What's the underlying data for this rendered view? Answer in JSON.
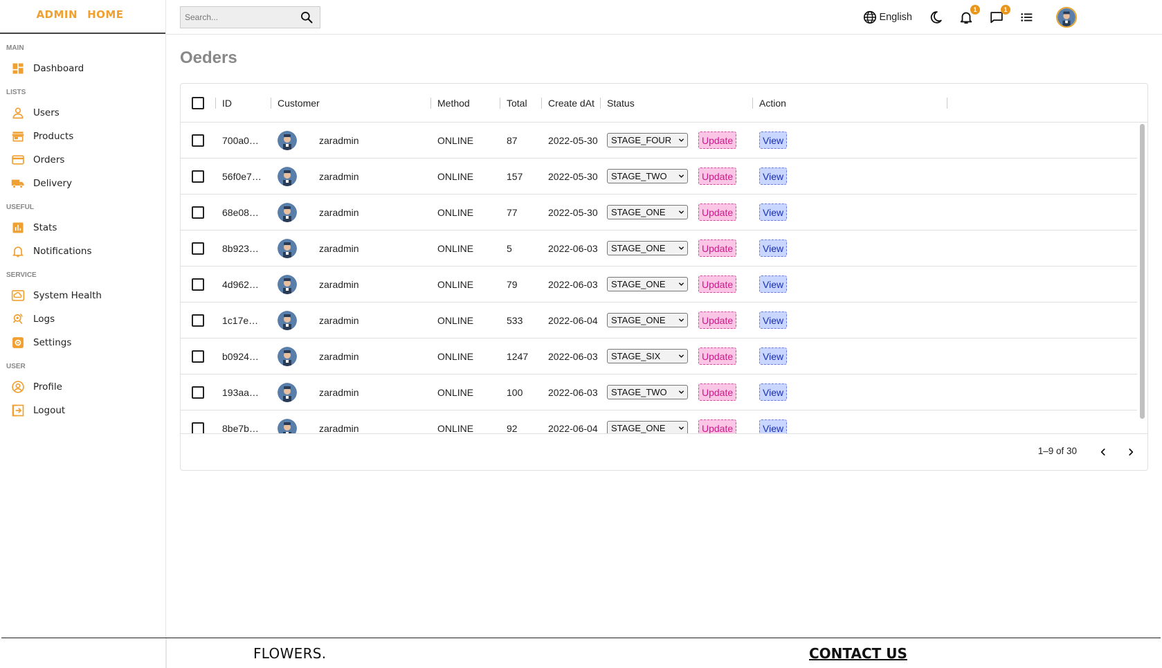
{
  "brand": {
    "part1": "ADMIN",
    "part2": "HOME"
  },
  "sidebar": {
    "sections": [
      {
        "title": "MAIN",
        "items": [
          {
            "label": "Dashboard",
            "icon": "dashboard-icon"
          }
        ]
      },
      {
        "title": "LISTS",
        "items": [
          {
            "label": "Users",
            "icon": "user-icon"
          },
          {
            "label": "Products",
            "icon": "store-icon"
          },
          {
            "label": "Orders",
            "icon": "credit-card-icon"
          },
          {
            "label": "Delivery",
            "icon": "truck-icon"
          }
        ]
      },
      {
        "title": "USEFUL",
        "items": [
          {
            "label": "Stats",
            "icon": "stats-icon"
          },
          {
            "label": "Notifications",
            "icon": "bell-icon"
          }
        ]
      },
      {
        "title": "SERVICE",
        "items": [
          {
            "label": "System Health",
            "icon": "system-health-icon"
          },
          {
            "label": "Logs",
            "icon": "logs-icon"
          },
          {
            "label": "Settings",
            "icon": "settings-icon"
          }
        ]
      },
      {
        "title": "USER",
        "items": [
          {
            "label": "Profile",
            "icon": "profile-icon"
          },
          {
            "label": "Logout",
            "icon": "logout-icon"
          }
        ]
      }
    ]
  },
  "topbar": {
    "search_placeholder": "Search...",
    "language": "English",
    "notifications_count": "1",
    "messages_count": "1"
  },
  "page": {
    "title": "Oeders"
  },
  "table": {
    "columns": [
      "ID",
      "Customer",
      "Method",
      "Total",
      "Create dAt",
      "Status",
      "Action"
    ],
    "rows": [
      {
        "id": "700a0…",
        "customer": "zaradmin",
        "method": "ONLINE",
        "total": "87",
        "created": "2022-05-30",
        "status": "STAGE_FOUR"
      },
      {
        "id": "56f0e7…",
        "customer": "zaradmin",
        "method": "ONLINE",
        "total": "157",
        "created": "2022-05-30",
        "status": "STAGE_TWO"
      },
      {
        "id": "68e08…",
        "customer": "zaradmin",
        "method": "ONLINE",
        "total": "77",
        "created": "2022-05-30",
        "status": "STAGE_ONE"
      },
      {
        "id": "8b923…",
        "customer": "zaradmin",
        "method": "ONLINE",
        "total": "5",
        "created": "2022-06-03",
        "status": "STAGE_ONE"
      },
      {
        "id": "4d962…",
        "customer": "zaradmin",
        "method": "ONLINE",
        "total": "79",
        "created": "2022-06-03",
        "status": "STAGE_ONE"
      },
      {
        "id": "1c17e…",
        "customer": "zaradmin",
        "method": "ONLINE",
        "total": "533",
        "created": "2022-06-04",
        "status": "STAGE_ONE"
      },
      {
        "id": "b0924…",
        "customer": "zaradmin",
        "method": "ONLINE",
        "total": "1247",
        "created": "2022-06-03",
        "status": "STAGE_SIX"
      },
      {
        "id": "193aa…",
        "customer": "zaradmin",
        "method": "ONLINE",
        "total": "100",
        "created": "2022-06-03",
        "status": "STAGE_TWO"
      },
      {
        "id": "8be7b…",
        "customer": "zaradmin",
        "method": "ONLINE",
        "total": "92",
        "created": "2022-06-04",
        "status": "STAGE_ONE"
      }
    ],
    "update_label": "Update",
    "view_label": "View",
    "pagination": "1–9 of 30"
  },
  "footer": {
    "brand": "FLOWERS.",
    "contact": "CONTACT US"
  },
  "colors": {
    "accent": "#f0a030",
    "update_bg": "#fbc6e6",
    "view_bg": "#c9d6ff"
  }
}
